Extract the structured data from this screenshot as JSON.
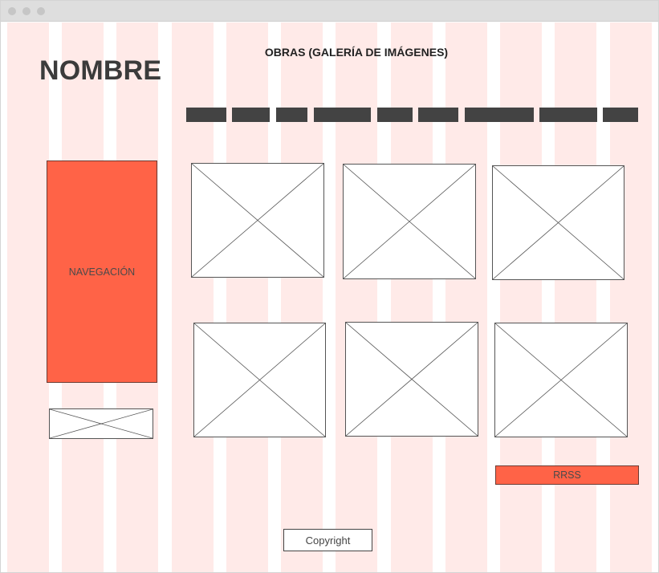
{
  "window": {
    "controls": [
      "close-dot",
      "minimize-dot",
      "maximize-dot"
    ]
  },
  "header": {
    "title": "NOMBRE",
    "section_title": "OBRAS (GALERÍA DE IMÁGENES)"
  },
  "menu": {
    "item_count": 9
  },
  "sidebar": {
    "nav_label": "NAVEGACIÓN"
  },
  "gallery": {
    "image_count": 6
  },
  "social": {
    "label": "RRSS"
  },
  "footer": {
    "copyright": "Copyright"
  },
  "colors": {
    "accent": "#ff6347",
    "grid_column": "#ffeae8",
    "menu_bar": "#434343",
    "title_text": "#3b3b3b"
  }
}
